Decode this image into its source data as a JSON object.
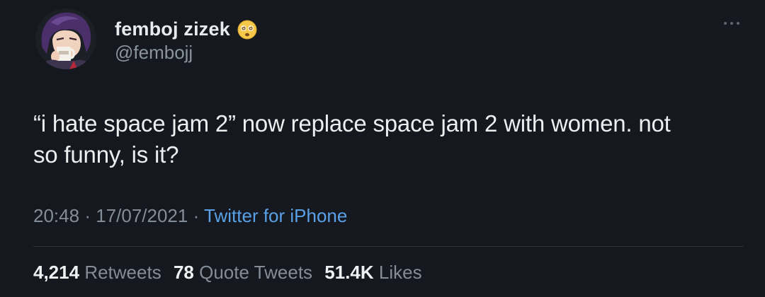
{
  "author": {
    "display_name": "femboj zizek",
    "handle": "@fembojj",
    "badge_icon": "dizzy-face-emoji",
    "avatar_icon": "anime-character-avatar"
  },
  "tweet": {
    "text_line1": "“i hate space jam 2” now replace space jam 2 with women. not",
    "text_line2": "so funny, is it?"
  },
  "meta": {
    "time": "20:48",
    "separator": "·",
    "date": "17/07/2021",
    "source": "Twitter for iPhone"
  },
  "stats": {
    "retweets_count": "4,214",
    "retweets_label": "Retweets",
    "quotes_count": "78",
    "quotes_label": "Quote Tweets",
    "likes_count": "51.4K",
    "likes_label": "Likes"
  },
  "colors": {
    "background": "#15181f",
    "text": "#eceef0",
    "secondary": "#848d97",
    "link": "#5aa0e6"
  }
}
